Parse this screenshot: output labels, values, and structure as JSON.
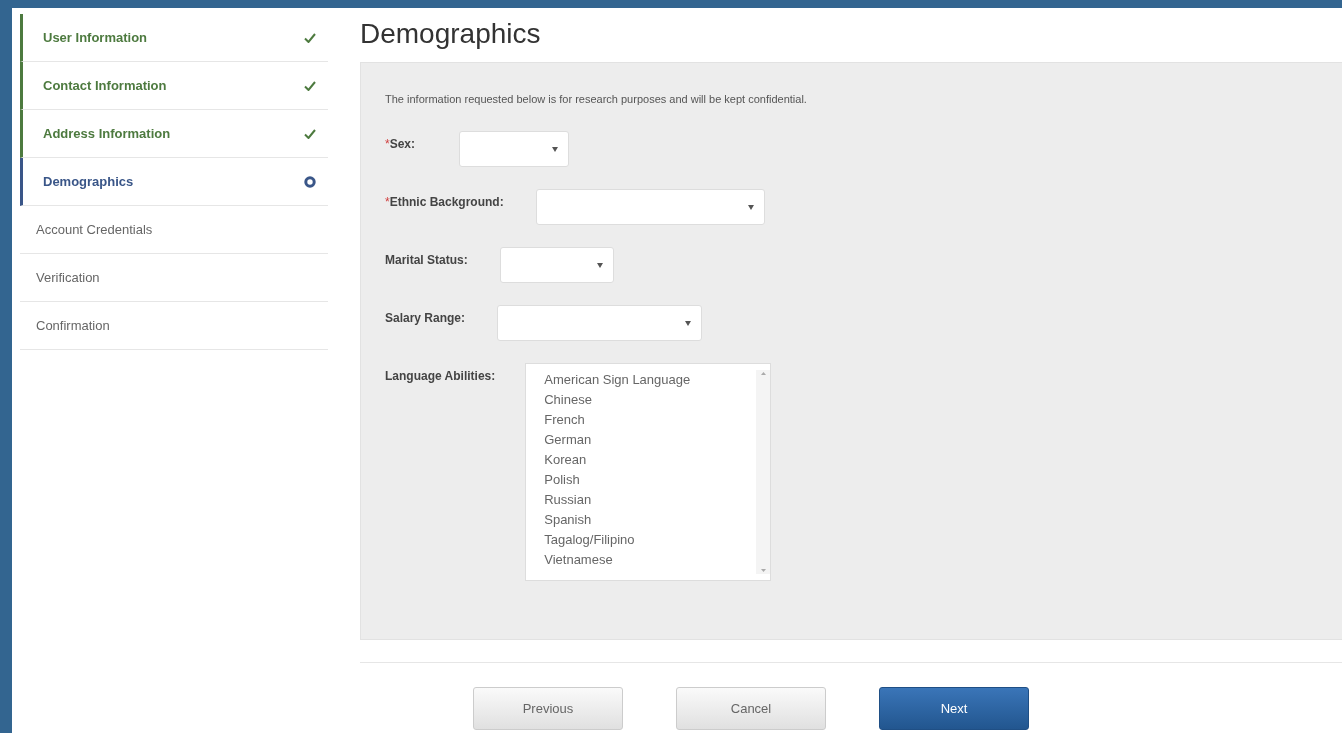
{
  "steps": [
    {
      "label": "User Information",
      "completed": true,
      "selected": false
    },
    {
      "label": "Contact Information",
      "completed": true,
      "selected": false
    },
    {
      "label": "Address Information",
      "completed": true,
      "selected": false
    },
    {
      "label": "Demographics",
      "completed": false,
      "selected": true
    },
    {
      "label": "Account Credentials",
      "completed": false,
      "selected": false
    },
    {
      "label": "Verification",
      "completed": false,
      "selected": false
    },
    {
      "label": "Confirmation",
      "completed": false,
      "selected": false
    }
  ],
  "title": "Demographics",
  "intro": "The information requested below is for research purposes and will be kept confidential.",
  "fields": [
    {
      "kind": "select",
      "label": "Sex:",
      "required_mark": "*"
    },
    {
      "kind": "select",
      "label": "Ethnic Background:",
      "required_mark": "*"
    },
    {
      "kind": "select",
      "label": "Marital Status:"
    },
    {
      "kind": "select",
      "label": "Salary Range:"
    },
    {
      "kind": "listbox",
      "label": "Language Abilities:",
      "options": [
        "American Sign Language",
        "Chinese",
        "French",
        "German",
        "Korean",
        "Polish",
        "Russian",
        "Spanish",
        "Tagalog/Filipino",
        "Vietnamese"
      ]
    }
  ],
  "buttons": [
    {
      "label": "Previous",
      "kind": "default"
    },
    {
      "label": "Cancel",
      "kind": "default"
    },
    {
      "label": "Next",
      "kind": "primary"
    }
  ]
}
